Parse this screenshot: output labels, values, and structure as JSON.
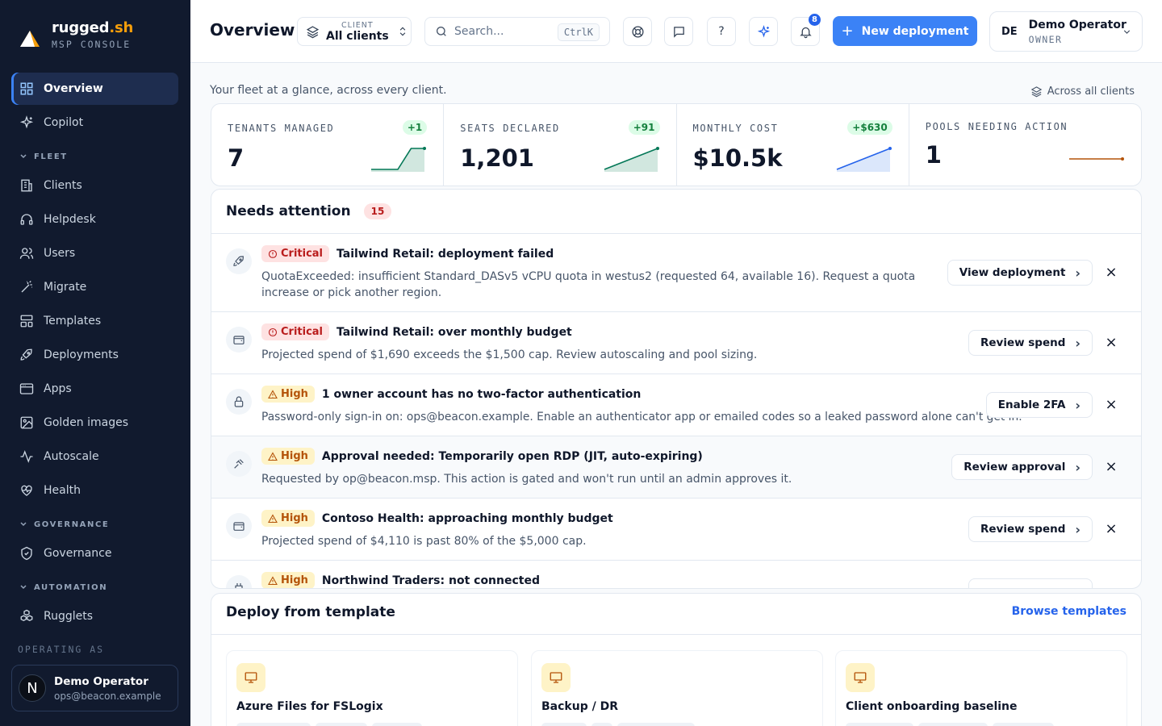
{
  "brand": {
    "name_main": "rugged",
    "name_accent": ".sh",
    "subtitle": "MSP CONSOLE"
  },
  "sidebar": {
    "items": [
      {
        "label": "Overview",
        "icon": "grid-icon",
        "active": true
      },
      {
        "label": "Copilot",
        "icon": "sparkles-icon"
      }
    ],
    "fleet_label": "FLEET",
    "fleet": [
      {
        "label": "Clients",
        "icon": "building-icon"
      },
      {
        "label": "Helpdesk",
        "icon": "headset-icon"
      },
      {
        "label": "Users",
        "icon": "users-icon"
      },
      {
        "label": "Migrate",
        "icon": "wand-icon"
      },
      {
        "label": "Templates",
        "icon": "template-icon"
      },
      {
        "label": "Deployments",
        "icon": "rocket-icon"
      },
      {
        "label": "Apps",
        "icon": "app-window-icon"
      },
      {
        "label": "Golden images",
        "icon": "image-icon"
      },
      {
        "label": "Autoscale",
        "icon": "activity-icon"
      },
      {
        "label": "Health",
        "icon": "heart-pulse-icon"
      }
    ],
    "governance_label": "GOVERNANCE",
    "governance": [
      {
        "label": "Governance",
        "icon": "shield-check-icon"
      }
    ],
    "automation_label": "AUTOMATION",
    "automation": [
      {
        "label": "Rugglets",
        "icon": "boxes-icon"
      }
    ],
    "operating_as_label": "OPERATING AS",
    "operator": {
      "avatar": "N",
      "name": "Demo Operator",
      "email": "ops@beacon.example"
    }
  },
  "topbar": {
    "title": "Overview",
    "client_label": "CLIENT",
    "client_value": "All clients",
    "search_placeholder": "Search...",
    "search_shortcut": "CtrlK",
    "help_label": "?",
    "notifications_count": "8",
    "new_deployment_label": "New deployment",
    "user_initials": "DE",
    "user_name": "Demo Operator",
    "user_role": "OWNER"
  },
  "overview": {
    "subtitle": "Your fleet at a glance, across every client.",
    "scope_label": "Across all clients"
  },
  "kpis": [
    {
      "label": "TENANTS MANAGED",
      "value": "7",
      "delta": "+1",
      "trend": [
        0,
        0,
        0,
        1,
        1
      ],
      "color": "#047857",
      "fill": "#d1e7df"
    },
    {
      "label": "SEATS DECLARED",
      "value": "1,201",
      "delta": "+91",
      "trend": [
        0,
        0.25,
        0.5,
        0.75,
        1
      ],
      "color": "#047857",
      "fill": "#d1e7df"
    },
    {
      "label": "MONTHLY COST",
      "value": "$10.5k",
      "delta": "+$630",
      "trend": [
        0,
        0.25,
        0.5,
        0.75,
        1
      ],
      "color": "#2563eb",
      "fill": "#dbe7fb"
    },
    {
      "label": "POOLS NEEDING ACTION",
      "value": "1",
      "delta": "",
      "trend": [
        0.5,
        0.5,
        0.5,
        0.5,
        0.5
      ],
      "color": "#b45309",
      "fill": ""
    }
  ],
  "attention": {
    "title": "Needs attention",
    "count": "15",
    "items": [
      {
        "icon": "rocket-icon",
        "severity": "Critical",
        "sev_class": "crit",
        "title": "Tailwind Retail: deployment failed",
        "desc": "QuotaExceeded: insufficient Standard_DASv5 vCPU quota in westus2 (requested 64, available 16). Request a quota increase or pick another region.",
        "action": "View deployment"
      },
      {
        "icon": "wallet-icon",
        "severity": "Critical",
        "sev_class": "crit",
        "title": "Tailwind Retail: over monthly budget",
        "desc": "Projected spend of $1,690 exceeds the $1,500 cap. Review autoscaling and pool sizing.",
        "action": "Review spend"
      },
      {
        "icon": "lock-icon",
        "severity": "High",
        "sev_class": "high",
        "title": "1 owner account has no two-factor authentication",
        "desc": "Password-only sign-in on: ops@beacon.example. Enable an authenticator app or emailed codes so a leaked password alone can't get in.",
        "action": "Enable 2FA"
      },
      {
        "icon": "gavel-icon",
        "severity": "High",
        "sev_class": "high",
        "title": "Approval needed: Temporarily open RDP (JIT, auto-expiring)",
        "desc": "Requested by op@beacon.msp. This action is gated and won't run until an admin approves it.",
        "action": "Review approval"
      },
      {
        "icon": "wallet-icon",
        "severity": "High",
        "sev_class": "high",
        "title": "Contoso Health: approaching monthly budget",
        "desc": "Projected spend of $4,110 is past 80% of the $5,000 cap.",
        "action": "Review spend"
      },
      {
        "icon": "plug-icon",
        "severity": "High",
        "sev_class": "high",
        "title": "Northwind Traders: not connected",
        "desc": "",
        "action": ""
      }
    ]
  },
  "deploy": {
    "title": "Deploy from template",
    "browse_label": "Browse templates",
    "templates": [
      {
        "name": "Azure Files for FSLogix",
        "icon": "monitor-icon"
      },
      {
        "name": "Backup / DR",
        "icon": "monitor-icon"
      },
      {
        "name": "Client onboarding baseline",
        "icon": "monitor-icon"
      }
    ]
  }
}
